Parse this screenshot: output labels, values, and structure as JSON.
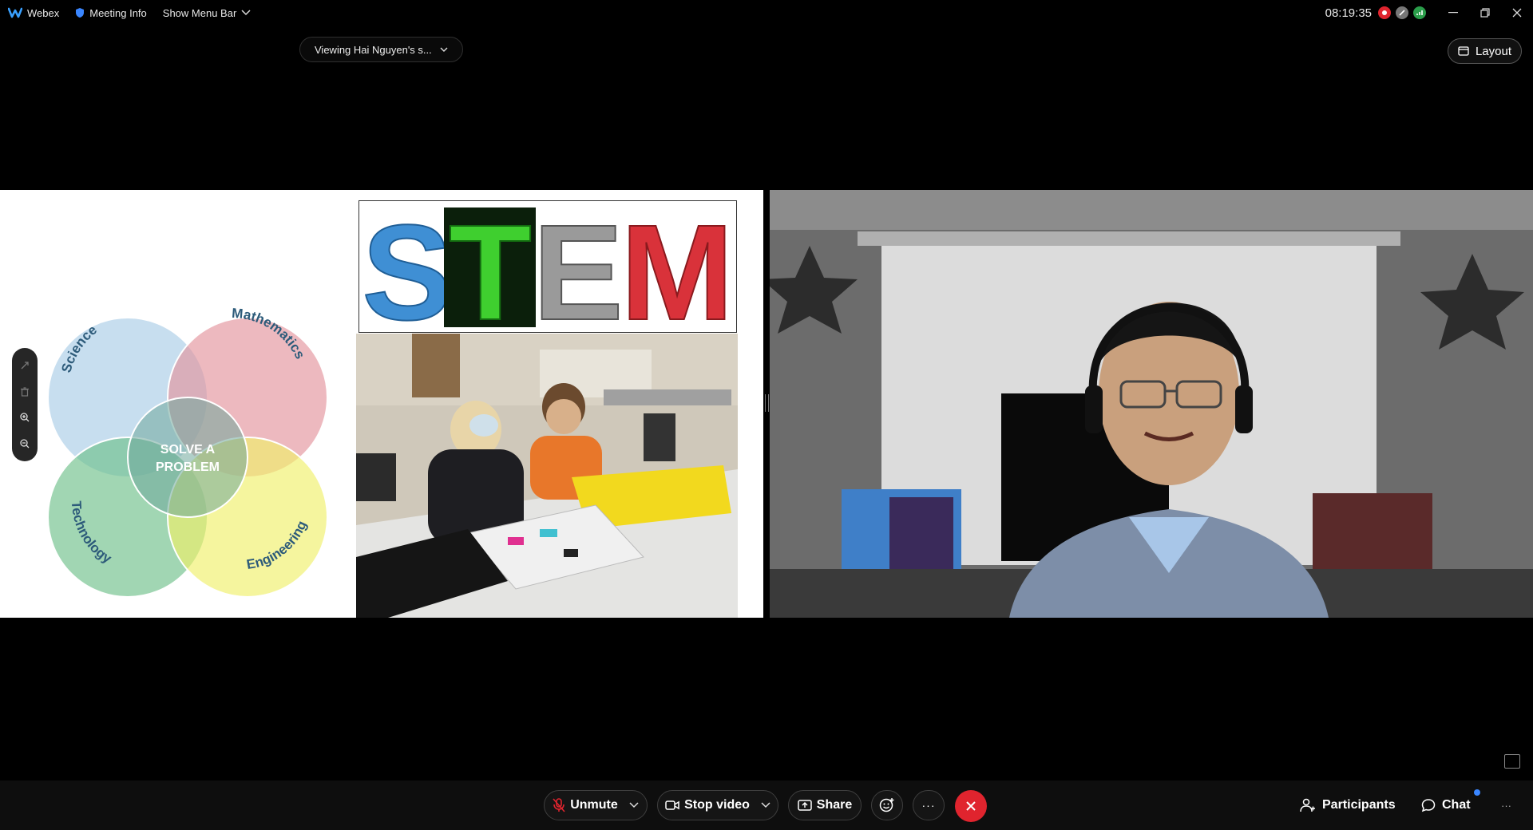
{
  "titlebar": {
    "app_name": "Webex",
    "meeting_info": "Meeting Info",
    "show_menu_bar": "Show Menu Bar",
    "clock": "08:19:35"
  },
  "viewing": {
    "label": "Viewing Hai Nguyen's s..."
  },
  "layout": {
    "label": "Layout"
  },
  "slide": {
    "venn": {
      "science": "Science",
      "mathematics": "Mathematics",
      "technology": "Technology",
      "engineering": "Engineering",
      "center_line1": "SOLVE A",
      "center_line2": "PROBLEM"
    },
    "stem_letters": [
      "S",
      "T",
      "E",
      "M"
    ]
  },
  "toolbar": {
    "unmute": "Unmute",
    "stop_video": "Stop video",
    "share": "Share",
    "more": "···",
    "participants": "Participants",
    "chat": "Chat",
    "overflow": "···"
  },
  "colors": {
    "end_call": "#e0242e",
    "science": "#a9cde6",
    "mathematics": "#e3939c",
    "technology": "#6fc08a",
    "engineering": "#efef6a",
    "chat_badge": "#3a86ff"
  }
}
